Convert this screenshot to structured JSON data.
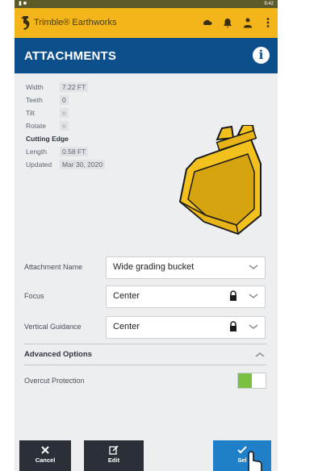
{
  "statusbar": {
    "left": "▮ ■",
    "right": "9:42"
  },
  "app": {
    "title": "Trimble® Earthworks"
  },
  "header": {
    "title": "ATTACHMENTS"
  },
  "specs": {
    "width_label": "Width",
    "width_value": "7.22 FT",
    "teeth_label": "Teeth",
    "teeth_value": "0",
    "tilt_label": "Tilt",
    "tilt_value": "○",
    "rotate_label": "Rotate",
    "rotate_value": "○",
    "cutting_edge_heading": "Cutting Edge",
    "length_label": "Length",
    "length_value": "0.58 FT",
    "updated_label": "Updated",
    "updated_value": "Mar 30, 2020"
  },
  "form": {
    "attachment_name": {
      "label": "Attachment Name",
      "value": "Wide grading bucket"
    },
    "focus": {
      "label": "Focus",
      "value": "Center"
    },
    "vertical_guidance": {
      "label": "Vertical Guidance",
      "value": "Center"
    }
  },
  "advanced": {
    "title": "Advanced Options",
    "overcut_label": "Overcut Protection",
    "overcut_on": true
  },
  "buttons": {
    "cancel": "Cancel",
    "edit": "Edit",
    "select": "Sel"
  },
  "colors": {
    "appbar": "#f3b51a",
    "titlebar": "#0d4f8b",
    "accent_button": "#1f80c8",
    "toggle_on": "#7ac143",
    "bucket": "#f2c11d"
  }
}
